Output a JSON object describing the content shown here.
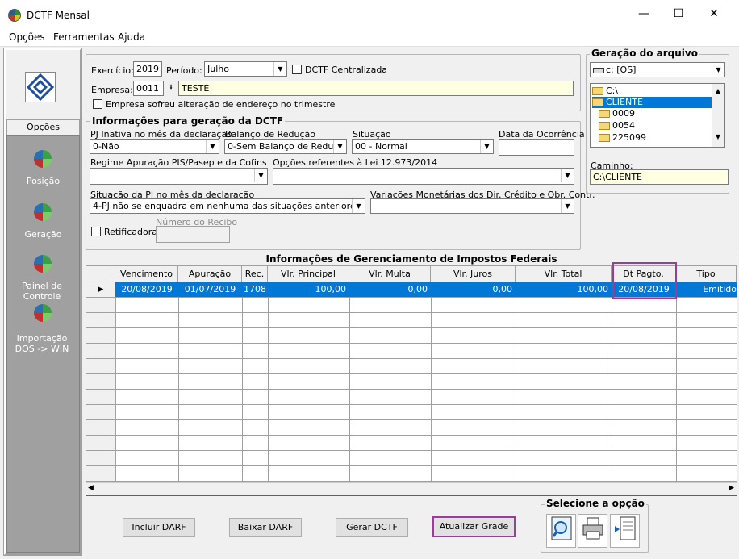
{
  "window": {
    "title": "DCTF Mensal",
    "minimize": "—",
    "maximize": "☐",
    "close": "✕"
  },
  "menu": [
    {
      "label": "Opções"
    },
    {
      "label": "Ferramentas"
    },
    {
      "label": "Ajuda"
    }
  ],
  "sidebar": {
    "tab": "Opções",
    "items": [
      {
        "label": "Posição",
        "icon": "globe-icon"
      },
      {
        "label": "Geração",
        "icon": "globe-icon"
      },
      {
        "label": "Painel de Controle",
        "icon": "globe-icon"
      },
      {
        "label": "Importação DOS -> WIN",
        "icon": "globe-icon"
      }
    ]
  },
  "header": {
    "exercicio_label": "Exercício:",
    "exercicio": "2019",
    "periodo_label": "Período:",
    "periodo": "Julho",
    "centralizada_label": "DCTF Centralizada",
    "empresa_label": "Empresa:",
    "empresa_code": "0011",
    "empresa_name": "TESTE",
    "alteracao_label": "Empresa sofreu alteração de endereço no trimestre"
  },
  "geracao": {
    "title": "Informações para geração da DCTF",
    "pj_inativa_label": "PJ Inativa no mês da declaração",
    "pj_inativa": "0-Não",
    "balanco_label": "Balanço de Redução",
    "balanco": "0-Sem Balanço de Reduçã",
    "situacao_label": "Situação",
    "situacao": "00 - Normal",
    "data_ocorrencia_label": "Data da Ocorrência",
    "data_ocorrencia": "",
    "regime_label": "Regime Apuração PIS/Pasep e da Cofins",
    "regime": "",
    "opcoes_lei_label": "Opções referentes à Lei 12.973/2014",
    "opcoes_lei": "",
    "situacao_pj_label": "Situação da PJ no mês da declaração",
    "situacao_pj": "4-PJ não se enquadra em nenhuma das situações anteriores",
    "variacoes_label": "Variações Monetárias dos Dir. Crédito e Obr. Contr.",
    "variacoes": "",
    "retificadora_label": "Retificadora",
    "recibo_label": "Número do Recibo",
    "recibo": ""
  },
  "arquivo": {
    "title": "Geração do arquivo",
    "drive": "c: [OS]",
    "folders": [
      "C:\\",
      "CLIENTE",
      "0009",
      "0054",
      "225099"
    ],
    "caminho_label": "Caminho:",
    "caminho": "C:\\CLIENTE"
  },
  "grid": {
    "title": "Informações de Gerenciamento de Impostos Federais",
    "columns": [
      "Vencimento",
      "Apuração",
      "Rec.",
      "Vlr. Principal",
      "Vlr. Multa",
      "Vlr. Juros",
      "Vlr. Total",
      "Dt Pagto.",
      "Tipo"
    ],
    "rows": [
      [
        "20/08/2019",
        "01/07/2019",
        "1708",
        "100,00",
        "0,00",
        "0,00",
        "100,00",
        "20/08/2019",
        "Emitido"
      ]
    ]
  },
  "buttons": {
    "incluir": "Incluir DARF",
    "baixar": "Baixar DARF",
    "gerar": "Gerar DCTF",
    "atualizar": "Atualizar Grade"
  },
  "selecione": {
    "title": "Selecione a opção"
  },
  "colors": {
    "accent": "#0078d7",
    "highlight": "#9b3c9b",
    "sidebar": "#a0a0a0",
    "yellow_field": "#ffffe1"
  }
}
